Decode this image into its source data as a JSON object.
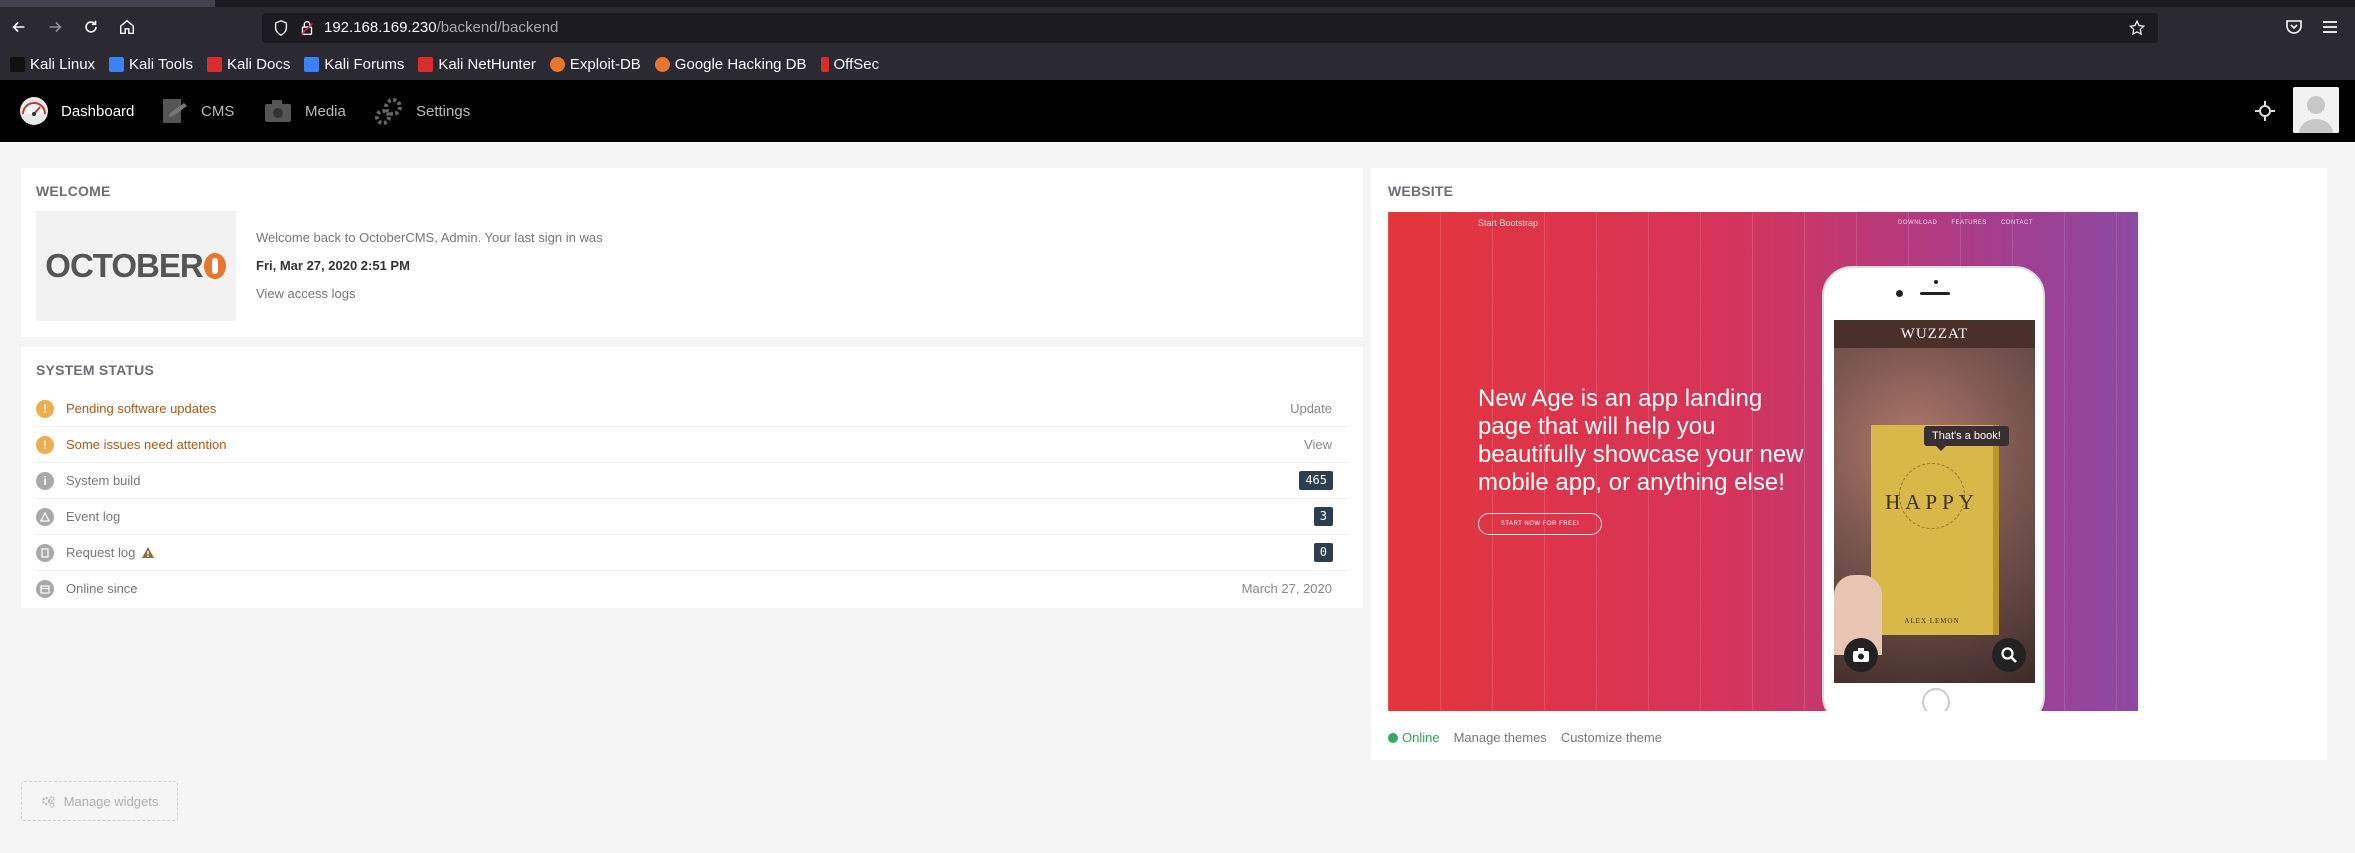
{
  "browser": {
    "url_host": "192.168.169.230",
    "url_path": "/backend/backend",
    "bookmarks": [
      {
        "label": "Kali Linux",
        "color": "#111111"
      },
      {
        "label": "Kali Tools",
        "color": "#3b82f6"
      },
      {
        "label": "Kali Docs",
        "color": "#d92c2c"
      },
      {
        "label": "Kali Forums",
        "color": "#3b82f6"
      },
      {
        "label": "Kali NetHunter",
        "color": "#d92c2c"
      },
      {
        "label": "Exploit-DB",
        "color": "#e8762c"
      },
      {
        "label": "Google Hacking DB",
        "color": "#e8762c"
      },
      {
        "label": "OffSec",
        "color": "#d92c2c"
      }
    ]
  },
  "app_nav": {
    "items": [
      {
        "label": "Dashboard",
        "icon": "dashboard-gauge-icon"
      },
      {
        "label": "CMS",
        "icon": "cms-icon"
      },
      {
        "label": "Media",
        "icon": "media-camera-icon"
      },
      {
        "label": "Settings",
        "icon": "settings-gears-icon"
      }
    ]
  },
  "welcome": {
    "title": "WELCOME",
    "logo_text_before": "OC",
    "logo_text_after": "BER",
    "logo_text_mid": "TO",
    "message": "Welcome back to OctoberCMS, Admin. Your last sign in was",
    "last_signin": "Fri, Mar 27, 2020 2:51 PM",
    "access_logs_link": "View access logs"
  },
  "system_status": {
    "title": "SYSTEM STATUS",
    "rows": [
      {
        "label": "Pending software updates",
        "action": "Update",
        "kind": "warning"
      },
      {
        "label": "Some issues need attention",
        "action": "View",
        "kind": "warning"
      },
      {
        "label": "System build",
        "badge": "465",
        "kind": "info"
      },
      {
        "label": "Event log",
        "badge": "3",
        "kind": "event"
      },
      {
        "label": "Request log",
        "badge": "0",
        "kind": "request"
      },
      {
        "label": "Online since",
        "value": "March 27, 2020",
        "kind": "calendar"
      }
    ]
  },
  "website": {
    "title": "WEBSITE",
    "preview": {
      "brand": "Start Bootstrap",
      "links": [
        "DOWNLOAD",
        "FEATURES",
        "CONTACT"
      ],
      "headline": "New Age is an app landing page that will help you beautifully showcase your new mobile app, or anything else!",
      "cta": "START NOW FOR FREE!",
      "app_name": "WUZZAT",
      "bubble": "That's a book!",
      "book_title": "HAPPY",
      "book_author": "ALEX LEMON"
    },
    "status": "Online",
    "manage_themes": "Manage themes",
    "customize_theme": "Customize theme"
  },
  "manage_widgets": "Manage widgets",
  "colors": {
    "warning": "#f0ad4e",
    "muted_icon": "#a9a9a9",
    "badge": "#2c3e50",
    "online": "#31ac5f",
    "brand_orange": "#e8762c"
  }
}
